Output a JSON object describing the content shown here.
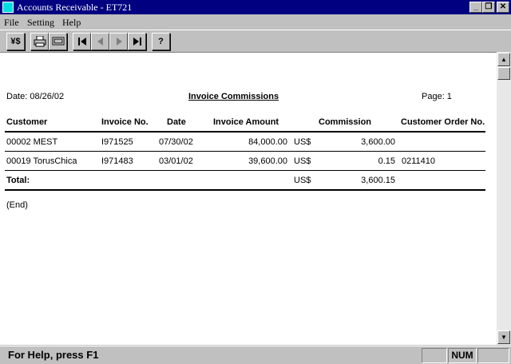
{
  "window": {
    "title": "Accounts Receivable - ET721"
  },
  "menu": {
    "file": "File",
    "setting": "Setting",
    "help": "Help"
  },
  "toolbar": {
    "currency_label": "¥$",
    "help_label": "?"
  },
  "report": {
    "date": "Date: 08/26/02",
    "title": "Invoice Commissions",
    "page": "Page: 1",
    "columns": {
      "customer": "Customer",
      "invoice_no": "Invoice No.",
      "date": "Date",
      "invoice_amount": "Invoice Amount",
      "commission": "Commission",
      "customer_order_no": "Customer Order No."
    },
    "rows": [
      {
        "customer": "00002 MEST",
        "invoice_no": "I971525",
        "date": "07/30/02",
        "amount": "84,000.00",
        "currency": "US$",
        "commission": "3,600.00",
        "order_no": ""
      },
      {
        "customer": "00019 TorusChica",
        "invoice_no": "I971483",
        "date": "03/01/02",
        "amount": "39,600.00",
        "currency": "US$",
        "commission": "0.15",
        "order_no": "0211410"
      }
    ],
    "total": {
      "label": "Total:",
      "currency": "US$",
      "commission": "3,600.15"
    },
    "end": "(End)"
  },
  "status": {
    "text": "For Help, press F1",
    "num": "NUM"
  }
}
